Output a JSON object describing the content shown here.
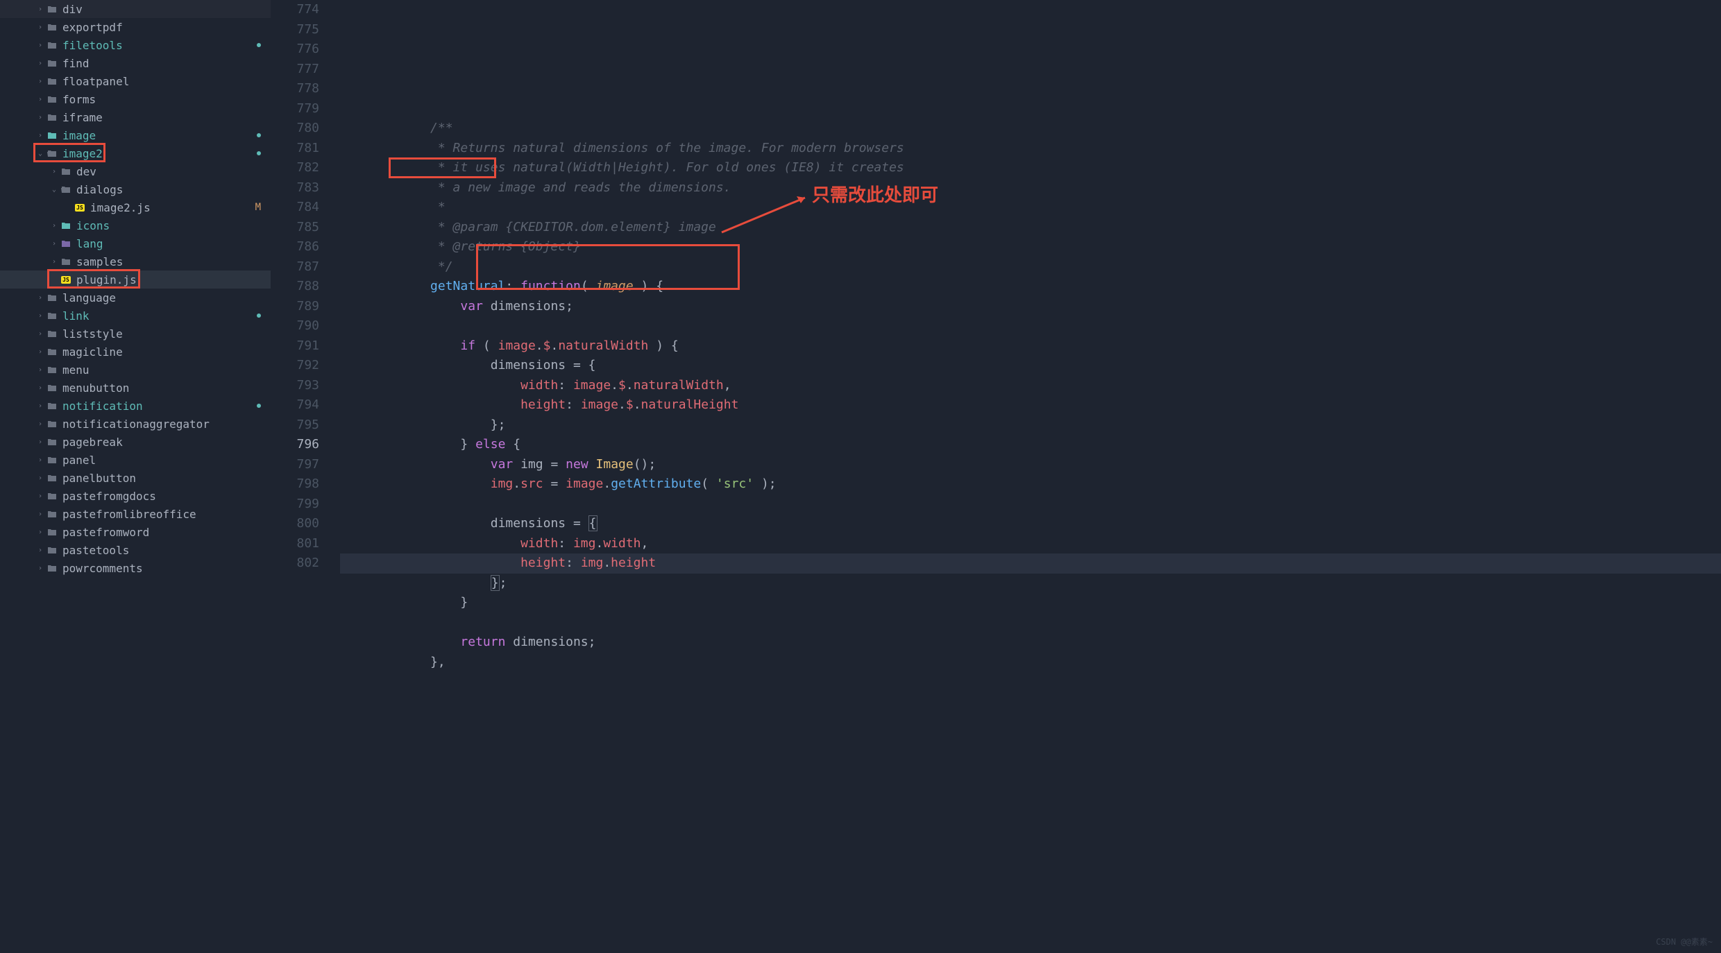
{
  "sidebar": {
    "items": [
      {
        "label": "div",
        "type": "folder",
        "indent": 1
      },
      {
        "label": "exportpdf",
        "type": "folder",
        "indent": 1
      },
      {
        "label": "filetools",
        "type": "folder",
        "indent": 1,
        "teal": true,
        "dot": true
      },
      {
        "label": "find",
        "type": "folder",
        "indent": 1
      },
      {
        "label": "floatpanel",
        "type": "folder",
        "indent": 1
      },
      {
        "label": "forms",
        "type": "folder",
        "indent": 1
      },
      {
        "label": "iframe",
        "type": "folder",
        "indent": 1
      },
      {
        "label": "image",
        "type": "folder-special",
        "indent": 1,
        "teal": true,
        "dot": true
      },
      {
        "label": "image2",
        "type": "folder-open",
        "indent": 1,
        "teal": true,
        "dot": true,
        "expanded": true,
        "redbox": true
      },
      {
        "label": "dev",
        "type": "folder",
        "indent": 2
      },
      {
        "label": "dialogs",
        "type": "folder-open",
        "indent": 2,
        "expanded": true
      },
      {
        "label": "image2.js",
        "type": "js-file",
        "indent": 3,
        "status": "M"
      },
      {
        "label": "icons",
        "type": "folder-special",
        "indent": 2,
        "teal": true
      },
      {
        "label": "lang",
        "type": "folder-lang",
        "indent": 2,
        "teal": true
      },
      {
        "label": "samples",
        "type": "folder",
        "indent": 2
      },
      {
        "label": "plugin.js",
        "type": "js-file",
        "indent": 2,
        "selected": true,
        "redbox": true
      },
      {
        "label": "language",
        "type": "folder",
        "indent": 1
      },
      {
        "label": "link",
        "type": "folder",
        "indent": 1,
        "teal": true,
        "dot": true
      },
      {
        "label": "liststyle",
        "type": "folder",
        "indent": 1
      },
      {
        "label": "magicline",
        "type": "folder",
        "indent": 1
      },
      {
        "label": "menu",
        "type": "folder",
        "indent": 1
      },
      {
        "label": "menubutton",
        "type": "folder",
        "indent": 1
      },
      {
        "label": "notification",
        "type": "folder",
        "indent": 1,
        "teal": true,
        "dot": true
      },
      {
        "label": "notificationaggregator",
        "type": "folder",
        "indent": 1
      },
      {
        "label": "pagebreak",
        "type": "folder",
        "indent": 1
      },
      {
        "label": "panel",
        "type": "folder",
        "indent": 1
      },
      {
        "label": "panelbutton",
        "type": "folder",
        "indent": 1
      },
      {
        "label": "pastefromgdocs",
        "type": "folder",
        "indent": 1
      },
      {
        "label": "pastefromlibreoffice",
        "type": "folder",
        "indent": 1
      },
      {
        "label": "pastefromword",
        "type": "folder",
        "indent": 1
      },
      {
        "label": "pastetools",
        "type": "folder",
        "indent": 1
      },
      {
        "label": "powrcomments",
        "type": "folder",
        "indent": 1
      }
    ]
  },
  "editor": {
    "line_start": 774,
    "current_line": 796,
    "lines": [
      {
        "n": 774,
        "html": "comment",
        "text": "            /**"
      },
      {
        "n": 775,
        "html": "comment",
        "text": "             * Returns natural dimensions of the image. For modern browsers"
      },
      {
        "n": 776,
        "html": "comment",
        "text": "             * it uses natural(Width|Height). For old ones (IE8) it creates"
      },
      {
        "n": 777,
        "html": "comment",
        "text": "             * a new image and reads the dimensions."
      },
      {
        "n": 778,
        "html": "comment",
        "text": "             *"
      },
      {
        "n": 779,
        "html": "comment",
        "text": "             * @param {CKEDITOR.dom.element} image"
      },
      {
        "n": 780,
        "html": "comment",
        "text": "             * @returns {Object}"
      },
      {
        "n": 781,
        "html": "comment",
        "text": "             */"
      },
      {
        "n": 782,
        "html": "code",
        "text": "            getNatural: function( image ) {"
      },
      {
        "n": 783,
        "html": "code",
        "text": "                var dimensions;"
      },
      {
        "n": 784,
        "html": "code",
        "text": ""
      },
      {
        "n": 785,
        "html": "code",
        "text": "                if ( image.$.naturalWidth ) {"
      },
      {
        "n": 786,
        "html": "code",
        "text": "                    dimensions = {"
      },
      {
        "n": 787,
        "html": "code",
        "text": "                        width: image.$.naturalWidth,"
      },
      {
        "n": 788,
        "html": "code",
        "text": "                        height: image.$.naturalHeight"
      },
      {
        "n": 789,
        "html": "code",
        "text": "                    };"
      },
      {
        "n": 790,
        "html": "code",
        "text": "                } else {"
      },
      {
        "n": 791,
        "html": "code",
        "text": "                    var img = new Image();"
      },
      {
        "n": 792,
        "html": "code",
        "text": "                    img.src = image.getAttribute( 'src' );"
      },
      {
        "n": 793,
        "html": "code",
        "text": ""
      },
      {
        "n": 794,
        "html": "code",
        "text": "                    dimensions = {"
      },
      {
        "n": 795,
        "html": "code",
        "text": "                        width: img.width,"
      },
      {
        "n": 796,
        "html": "code",
        "text": "                        height: img.height"
      },
      {
        "n": 797,
        "html": "code",
        "text": "                    };"
      },
      {
        "n": 798,
        "html": "code",
        "text": "                }"
      },
      {
        "n": 799,
        "html": "code",
        "text": ""
      },
      {
        "n": 800,
        "html": "code",
        "text": "                return dimensions;"
      },
      {
        "n": 801,
        "html": "code",
        "text": "            },"
      },
      {
        "n": 802,
        "html": "code",
        "text": ""
      }
    ]
  },
  "annotation": {
    "text": "只需改此处即可"
  },
  "watermark": "CSDN @@素素~"
}
